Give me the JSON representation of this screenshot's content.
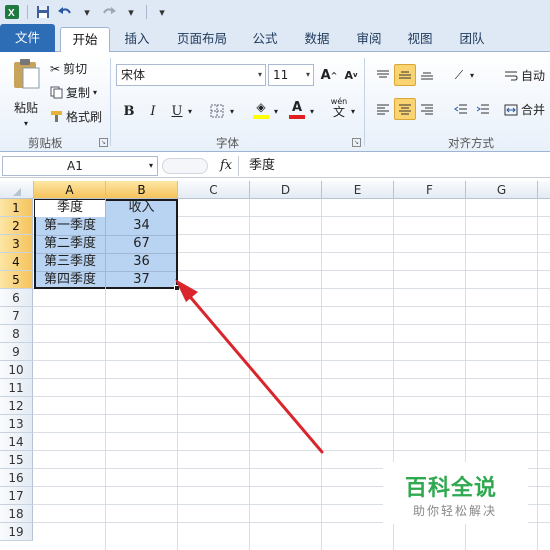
{
  "quick_access": {
    "save_icon": "save-icon",
    "undo_icon": "undo-icon",
    "redo_icon": "redo-icon"
  },
  "tabs": [
    {
      "label": "文件"
    },
    {
      "label": "开始"
    },
    {
      "label": "插入"
    },
    {
      "label": "页面布局"
    },
    {
      "label": "公式"
    },
    {
      "label": "数据"
    },
    {
      "label": "审阅"
    },
    {
      "label": "视图"
    },
    {
      "label": "团队"
    }
  ],
  "clipboard": {
    "paste_label": "粘贴",
    "cut_label": "剪切",
    "copy_label": "复制",
    "format_painter_label": "格式刷",
    "group_label": "剪贴板"
  },
  "font": {
    "font_name": "宋体",
    "font_size": "11",
    "bold": "B",
    "italic": "I",
    "underline": "U",
    "grow": "A",
    "shrink": "A",
    "wen": "wén",
    "wen_char": "文",
    "group_label": "字体",
    "font_color": "#e02020",
    "fill_color": "#ffff00"
  },
  "alignment": {
    "wrap_label": "自动",
    "merge_label": "合并",
    "group_label": "对齐方式"
  },
  "formula_bar": {
    "name_box": "A1",
    "fx": "fx",
    "content": "季度"
  },
  "columns": [
    "A",
    "B",
    "C",
    "D",
    "E",
    "F",
    "G"
  ],
  "rows": [
    "1",
    "2",
    "3",
    "4",
    "5",
    "6",
    "7",
    "8",
    "9",
    "10",
    "11",
    "12",
    "13",
    "14",
    "15",
    "16",
    "17",
    "18",
    "19"
  ],
  "table": {
    "header": [
      "季度",
      "收入"
    ],
    "data": [
      [
        "第一季度",
        "34"
      ],
      [
        "第二季度",
        "67"
      ],
      [
        "第三季度",
        "36"
      ],
      [
        "第四季度",
        "37"
      ]
    ]
  },
  "colors": {
    "selection": "#b9d4f2",
    "arrow": "#d9262c",
    "file_tab": "#2d6db5",
    "watermark": "#2fa84f"
  },
  "watermark": {
    "title": "百科全说",
    "subtitle": "助你轻松解决"
  }
}
